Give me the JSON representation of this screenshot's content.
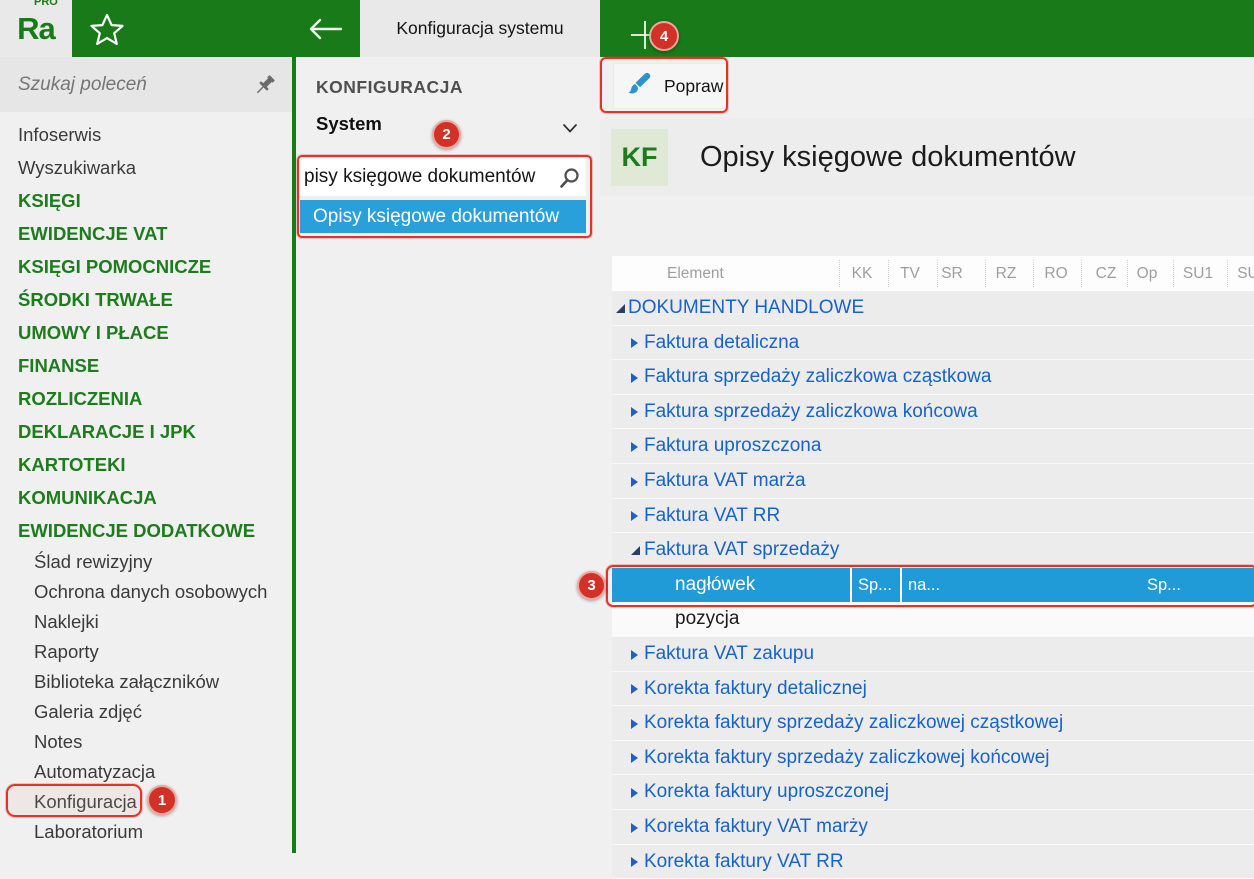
{
  "topbar": {
    "logo_text": "Ra",
    "logo_sup": "PRO",
    "tab_title": "Konfiguracja systemu"
  },
  "sidebar": {
    "search_placeholder": "Szukaj poleceń",
    "items": [
      {
        "label": "Infoserwis",
        "kind": "plain"
      },
      {
        "label": "Wyszukiwarka",
        "kind": "plain"
      },
      {
        "label": "KSIĘGI",
        "kind": "section"
      },
      {
        "label": "EWIDENCJE VAT",
        "kind": "section"
      },
      {
        "label": "KSIĘGI POMOCNICZE",
        "kind": "section"
      },
      {
        "label": "ŚRODKI TRWAŁE",
        "kind": "section"
      },
      {
        "label": "UMOWY I PŁACE",
        "kind": "section"
      },
      {
        "label": "FINANSE",
        "kind": "section"
      },
      {
        "label": "ROZLICZENIA",
        "kind": "section"
      },
      {
        "label": "DEKLARACJE I JPK",
        "kind": "section"
      },
      {
        "label": "KARTOTEKI",
        "kind": "section"
      },
      {
        "label": "KOMUNIKACJA",
        "kind": "section"
      },
      {
        "label": "EWIDENCJE DODATKOWE",
        "kind": "section"
      },
      {
        "label": "Ślad rewizyjny",
        "kind": "sub"
      },
      {
        "label": "Ochrona danych osobowych",
        "kind": "sub"
      },
      {
        "label": "Naklejki",
        "kind": "sub"
      },
      {
        "label": "Raporty",
        "kind": "sub"
      },
      {
        "label": "Biblioteka załączników",
        "kind": "sub"
      },
      {
        "label": "Galeria zdjęć",
        "kind": "sub"
      },
      {
        "label": "Notes",
        "kind": "sub"
      },
      {
        "label": "Automatyzacja",
        "kind": "sub"
      },
      {
        "label": "Konfiguracja",
        "kind": "sub",
        "annotated": true
      },
      {
        "label": "Laboratorium",
        "kind": "sub"
      }
    ]
  },
  "config_panel": {
    "title": "KONFIGURACJA",
    "category_value": "System",
    "search_value": "pisy księgowe dokumentów",
    "suggestion": "Opisy księgowe dokumentów"
  },
  "content": {
    "toolbar": {
      "edit_button": "Popraw"
    },
    "header": {
      "module_badge": "KF",
      "title": "Opisy księgowe dokumentów"
    },
    "table": {
      "columns": [
        "Element",
        "KK",
        "TV",
        "SR",
        "RZ",
        "RO",
        "CZ",
        "Op",
        "SU1",
        "SU"
      ],
      "rows": [
        {
          "label": "DOKUMENTY HANDLOWE",
          "level": 0,
          "expanded": true
        },
        {
          "label": "Faktura detaliczna",
          "level": 1,
          "expanded": false
        },
        {
          "label": "Faktura sprzedaży zaliczkowa cząstkowa",
          "level": 1,
          "expanded": false
        },
        {
          "label": "Faktura sprzedaży zaliczkowa końcowa",
          "level": 1,
          "expanded": false
        },
        {
          "label": "Faktura uproszczona",
          "level": 1,
          "expanded": false
        },
        {
          "label": "Faktura VAT marża",
          "level": 1,
          "expanded": false
        },
        {
          "label": "Faktura VAT RR",
          "level": 1,
          "expanded": false
        },
        {
          "label": "Faktura VAT sprzedaży",
          "level": 1,
          "expanded": true
        },
        {
          "label": "nagłówek",
          "level": 2,
          "selected": true,
          "cells": {
            "kk": "Sp...",
            "tv": "na...",
            "op": "Sp..."
          }
        },
        {
          "label": "pozycja",
          "level": 2,
          "light": true
        },
        {
          "label": "Faktura VAT zakupu",
          "level": 1,
          "expanded": false
        },
        {
          "label": "Korekta faktury detalicznej",
          "level": 1,
          "expanded": false
        },
        {
          "label": "Korekta faktury sprzedaży zaliczkowej cząstkowej",
          "level": 1,
          "expanded": false
        },
        {
          "label": "Korekta faktury sprzedaży zaliczkowej końcowej",
          "level": 1,
          "expanded": false
        },
        {
          "label": "Korekta faktury uproszczonej",
          "level": 1,
          "expanded": false
        },
        {
          "label": "Korekta faktury VAT marży",
          "level": 1,
          "expanded": false
        },
        {
          "label": "Korekta faktury VAT RR",
          "level": 1,
          "expanded": false
        }
      ]
    }
  },
  "annotations": {
    "step1": "1",
    "step2": "2",
    "step3": "3",
    "step4": "4",
    "accent_color": "#e23327"
  }
}
